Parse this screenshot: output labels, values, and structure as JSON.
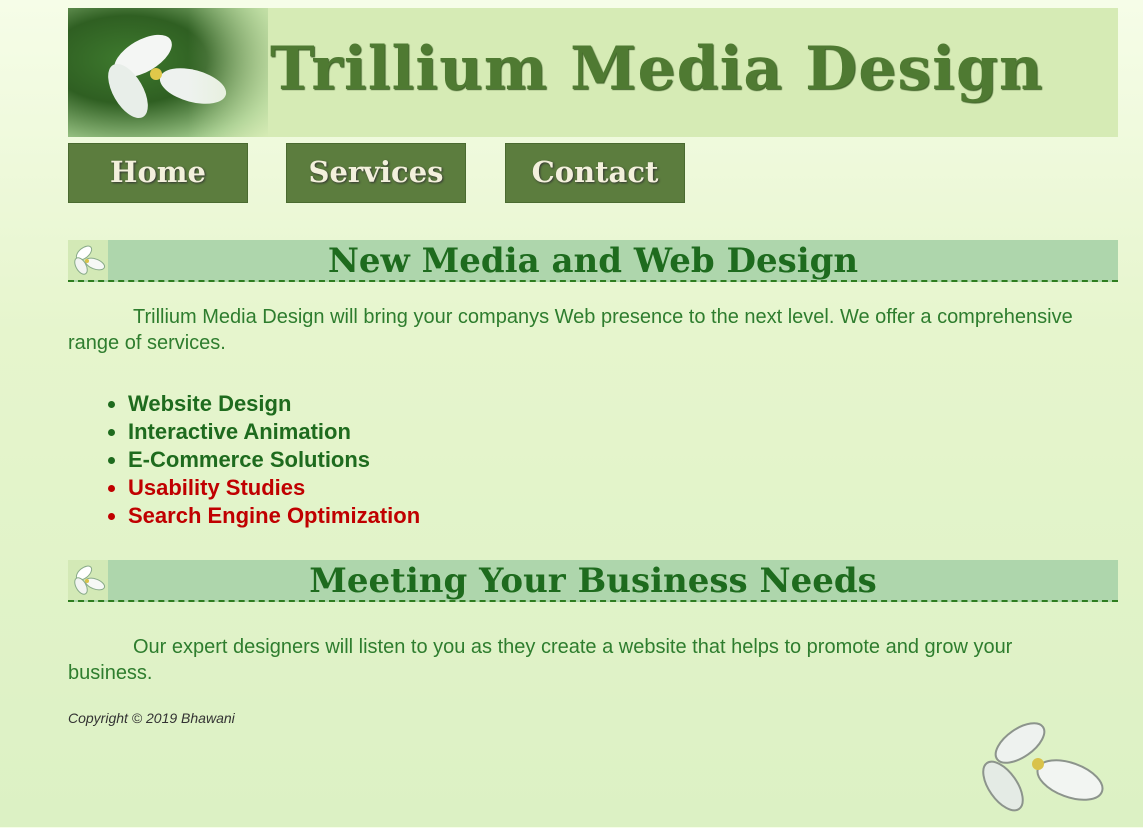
{
  "header": {
    "title": "Trillium Media Design"
  },
  "nav": {
    "items": [
      {
        "label": "Home"
      },
      {
        "label": "Services"
      },
      {
        "label": "Contact"
      }
    ]
  },
  "sections": [
    {
      "heading": "New Media and Web Design",
      "paragraph": "Trillium Media Design will bring your companys Web presence to the next level. We offer a comprehensive range of services."
    },
    {
      "heading": "Meeting Your Business Needs",
      "paragraph": "Our expert designers will listen to you as they create a website that helps to promote and grow your business."
    }
  ],
  "services": [
    {
      "label": "Website Design",
      "color": "#1e6b1e"
    },
    {
      "label": "Interactive Animation",
      "color": "#1e6b1e"
    },
    {
      "label": "E-Commerce Solutions",
      "color": "#1e6b1e"
    },
    {
      "label": "Usability Studies",
      "color": "#c00000"
    },
    {
      "label": "Search Engine Optimization",
      "color": "#c00000"
    }
  ],
  "footer": {
    "copyright": "Copyright © 2019 Bhawani"
  },
  "colors": {
    "nav_bg": "#5c7d3e",
    "heading_green": "#1e6b1e",
    "accent_red": "#c00000"
  }
}
